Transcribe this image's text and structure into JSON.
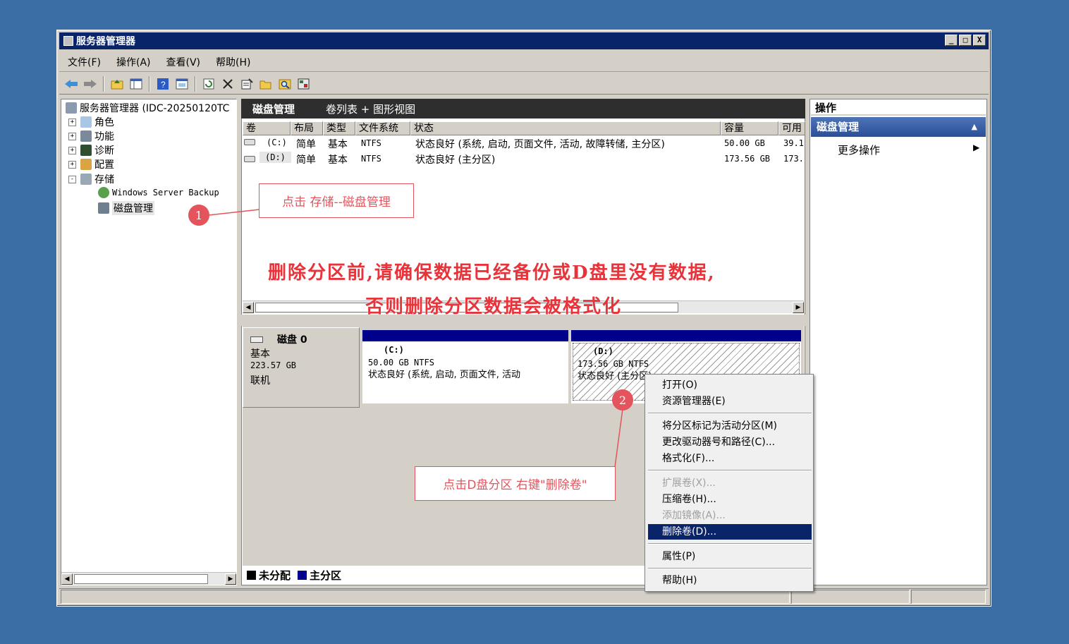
{
  "window": {
    "title": "服务器管理器",
    "controls": {
      "minimize": "_",
      "maximize": "□",
      "close": "X"
    }
  },
  "menu": [
    "文件(F)",
    "操作(A)",
    "查看(V)",
    "帮助(H)"
  ],
  "toolbar_icons": [
    "back-arrow-icon",
    "forward-arrow-icon",
    "up-folder-icon",
    "show-tree-icon",
    "help-icon",
    "view-icon",
    "refresh-icon",
    "delete-icon",
    "properties-icon",
    "open-icon",
    "find-icon",
    "export-icon"
  ],
  "tree": {
    "root": "服务器管理器 (IDC-20250120TC",
    "items": [
      {
        "label": "角色",
        "exp": "+"
      },
      {
        "label": "功能",
        "exp": "+"
      },
      {
        "label": "诊断",
        "exp": "+"
      },
      {
        "label": "配置",
        "exp": "+"
      },
      {
        "label": "存储",
        "exp": "-"
      }
    ],
    "children": [
      "Windows Server Backup",
      "磁盘管理"
    ]
  },
  "center": {
    "title": "磁盘管理",
    "subtitle": "卷列表 + 图形视图",
    "columns": [
      "卷",
      "布局",
      "类型",
      "文件系统",
      "状态",
      "容量",
      "可用"
    ],
    "rows": [
      {
        "vol": "(C:)",
        "layout": "简单",
        "type": "基本",
        "fs": "NTFS",
        "status": "状态良好 (系统, 启动, 页面文件, 活动, 故障转储, 主分区)",
        "cap": "50.00 GB",
        "free": "39.1"
      },
      {
        "vol": "(D:)",
        "layout": "简单",
        "type": "基本",
        "fs": "NTFS",
        "status": "状态良好 (主分区)",
        "cap": "173.56 GB",
        "free": "173."
      }
    ]
  },
  "disk": {
    "name": "磁盘 0",
    "type": "基本",
    "size": "223.57 GB",
    "state": "联机",
    "partitions": [
      {
        "label": "(C:)",
        "size": "50.00 GB NTFS",
        "status": "状态良好 (系统, 启动, 页面文件, 活动"
      },
      {
        "label": "(D:)",
        "size": "173.56 GB NTFS",
        "status": "状态良好 (主分区)"
      }
    ]
  },
  "legend": {
    "unallocated": "未分配",
    "primary": "主分区",
    "colors": {
      "unallocated": "#000000",
      "primary": "#00008b"
    }
  },
  "actions": {
    "header": "操作",
    "section": "磁盘管理",
    "more": "更多操作"
  },
  "context_menu": [
    {
      "label": "打开(O)",
      "state": "normal"
    },
    {
      "label": "资源管理器(E)",
      "state": "normal"
    },
    {
      "label": "将分区标记为活动分区(M)",
      "state": "normal"
    },
    {
      "label": "更改驱动器号和路径(C)...",
      "state": "normal"
    },
    {
      "label": "格式化(F)...",
      "state": "normal"
    },
    {
      "label": "扩展卷(X)...",
      "state": "disabled"
    },
    {
      "label": "压缩卷(H)...",
      "state": "normal"
    },
    {
      "label": "添加镜像(A)...",
      "state": "disabled"
    },
    {
      "label": "删除卷(D)...",
      "state": "highlighted"
    },
    {
      "label": "属性(P)",
      "state": "normal"
    },
    {
      "label": "帮助(H)",
      "state": "normal"
    }
  ],
  "annotations": {
    "step1_badge": "1",
    "step1_text": "点击 存储--磁盘管理",
    "step2_badge": "2",
    "step2_text": "点击D盘分区 右键\"删除卷\"",
    "warning_line1": "删除分区前,请确保数据已经备份或D盘里没有数据,",
    "warning_line2": "否则删除分区数据会被格式化",
    "color": "#e4545c"
  }
}
